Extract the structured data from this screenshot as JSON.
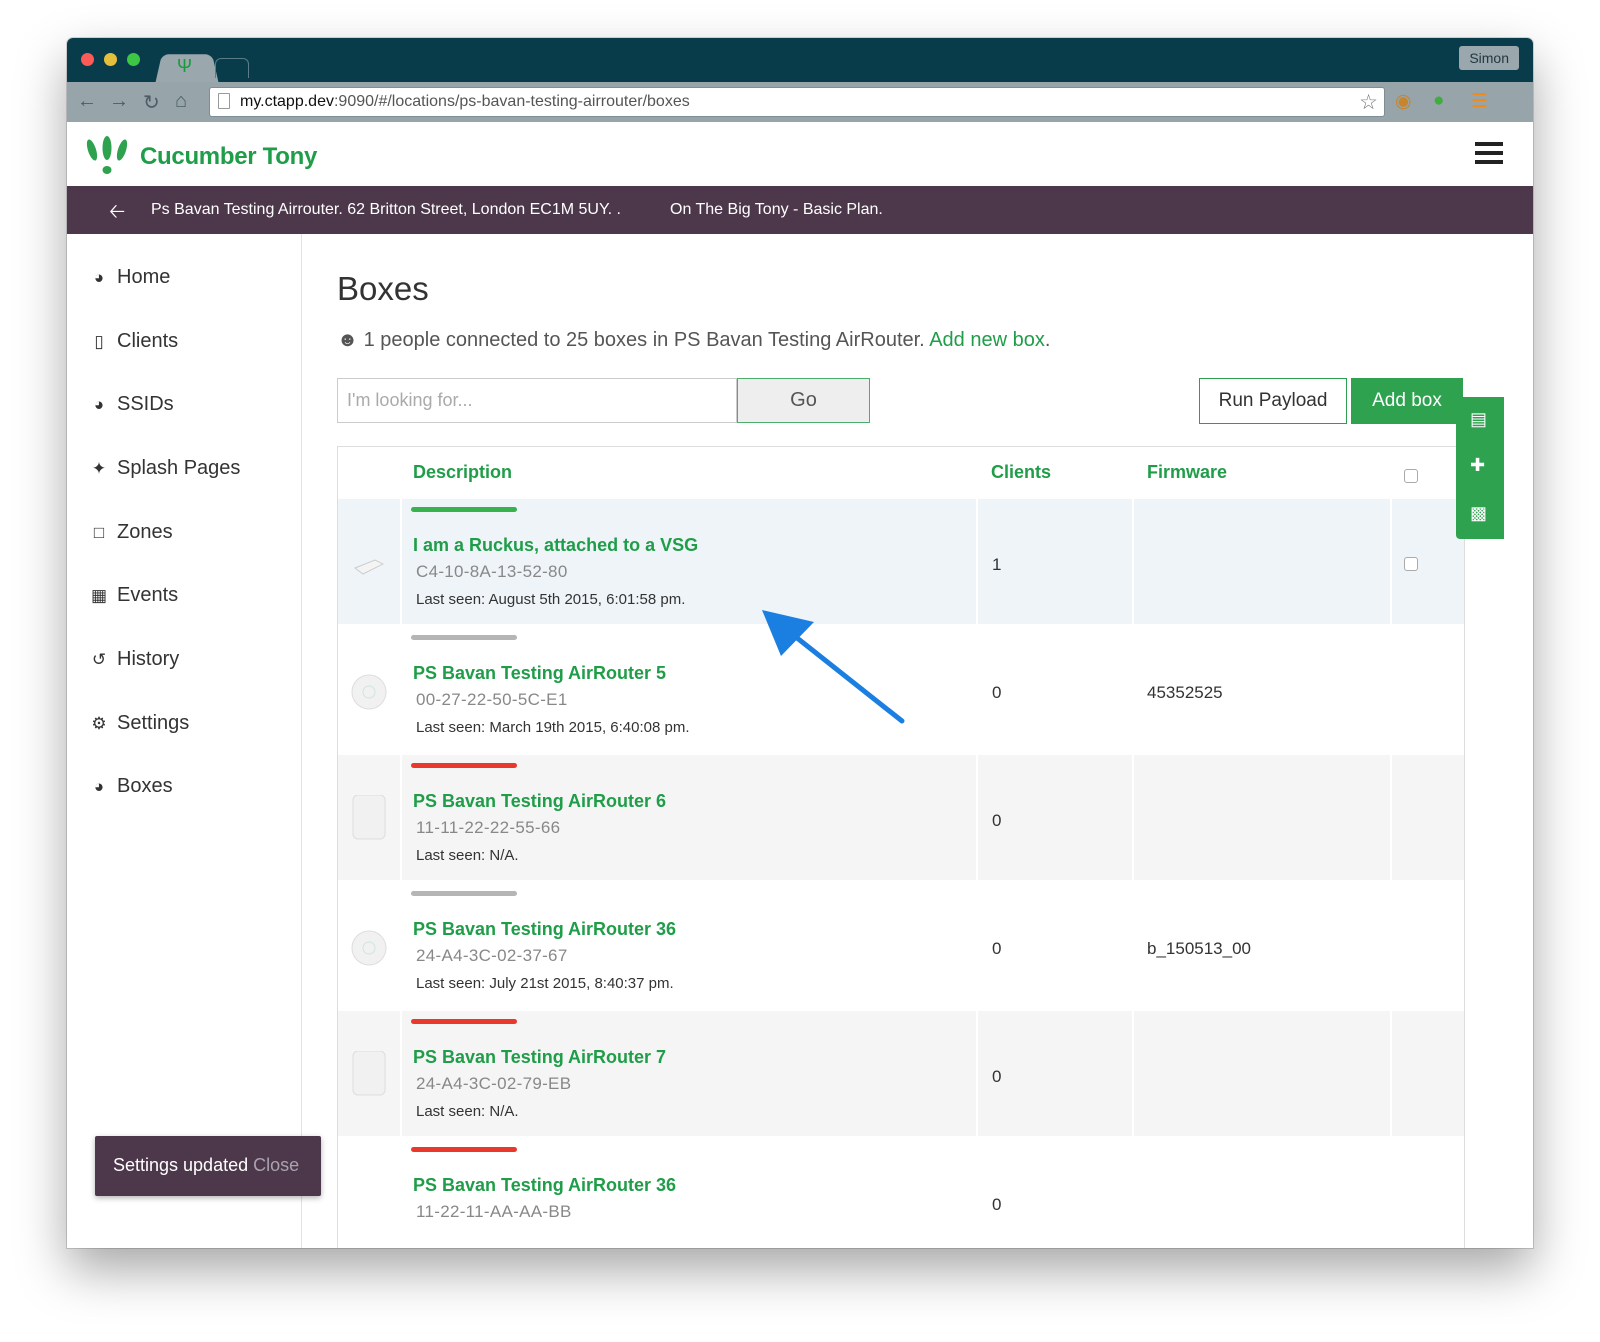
{
  "browser": {
    "profile": "Simon",
    "url_host": "my.ctapp.dev",
    "url_path": ":9090/#/locations/ps-bavan-testing-airrouter/boxes",
    "colors": {
      "titlebar": "#083c4a",
      "toolbar": "#97a5ab"
    }
  },
  "app": {
    "brand": "Cucumber Tony",
    "location_text": "Ps Bavan Testing Airrouter. 62 Britton Street, London EC1M 5UY. .",
    "plan_text": "On The Big Tony - Basic Plan.",
    "colors": {
      "primary": "#2ea24f",
      "nav_bar": "#4d384b"
    }
  },
  "sidebar": {
    "items": [
      {
        "label": "Home",
        "icon": "dashboard-icon"
      },
      {
        "label": "Clients",
        "icon": "tablet-icon"
      },
      {
        "label": "SSIDs",
        "icon": "wifi-icon"
      },
      {
        "label": "Splash Pages",
        "icon": "magic-wand-icon"
      },
      {
        "label": "Zones",
        "icon": "folder-icon"
      },
      {
        "label": "Events",
        "icon": "calendar-icon"
      },
      {
        "label": "History",
        "icon": "history-icon"
      },
      {
        "label": "Settings",
        "icon": "cogs-icon"
      },
      {
        "label": "Boxes",
        "icon": "wifi-icon"
      }
    ]
  },
  "toast": {
    "message": "Settings updated",
    "close_label": "Close"
  },
  "main": {
    "title": "Boxes",
    "summary": "1 people connected to 25 boxes in PS Bavan Testing AirRouter.",
    "summary_link": "Add new box",
    "summary_end": ".",
    "search_placeholder": "I'm looking for...",
    "go_label": "Go",
    "run_payload_label": "Run Payload",
    "add_box_label": "Add box"
  },
  "table": {
    "headers": {
      "description": "Description",
      "clients": "Clients",
      "firmware": "Firmware"
    },
    "rows": [
      {
        "title": "I am a Ruckus, attached to a VSG",
        "mac": "C4-10-8A-13-52-80",
        "last_seen": "Last seen: August 5th 2015, 6:01:58 pm.",
        "clients": "1",
        "firmware": "",
        "status": "online",
        "device": "ruckus"
      },
      {
        "title": "PS Bavan Testing AirRouter 5",
        "mac": "00-27-22-50-5C-E1",
        "last_seen": "Last seen: March 19th 2015, 6:40:08 pm.",
        "clients": "0",
        "firmware": "45352525",
        "status": "unknown",
        "device": "round"
      },
      {
        "title": "PS Bavan Testing AirRouter 6",
        "mac": "11-11-22-22-55-66",
        "last_seen": "Last seen: N/A.",
        "clients": "0",
        "firmware": "",
        "status": "offline",
        "device": "square"
      },
      {
        "title": "PS Bavan Testing AirRouter 36",
        "mac": "24-A4-3C-02-37-67",
        "last_seen": "Last seen: July 21st 2015, 8:40:37 pm.",
        "clients": "0",
        "firmware": "b_150513_00",
        "status": "unknown",
        "device": "round"
      },
      {
        "title": "PS Bavan Testing AirRouter 7",
        "mac": "24-A4-3C-02-79-EB",
        "last_seen": "Last seen: N/A.",
        "clients": "0",
        "firmware": "",
        "status": "offline",
        "device": "square"
      },
      {
        "title": "PS Bavan Testing AirRouter 36",
        "mac": "11-22-11-AA-AA-BB",
        "last_seen": "",
        "clients": "0",
        "firmware": "",
        "status": "offline",
        "device": "none"
      }
    ]
  },
  "status_colors": {
    "online": "#37b24d",
    "unknown": "#b5b5b5",
    "offline": "#e8392c"
  }
}
